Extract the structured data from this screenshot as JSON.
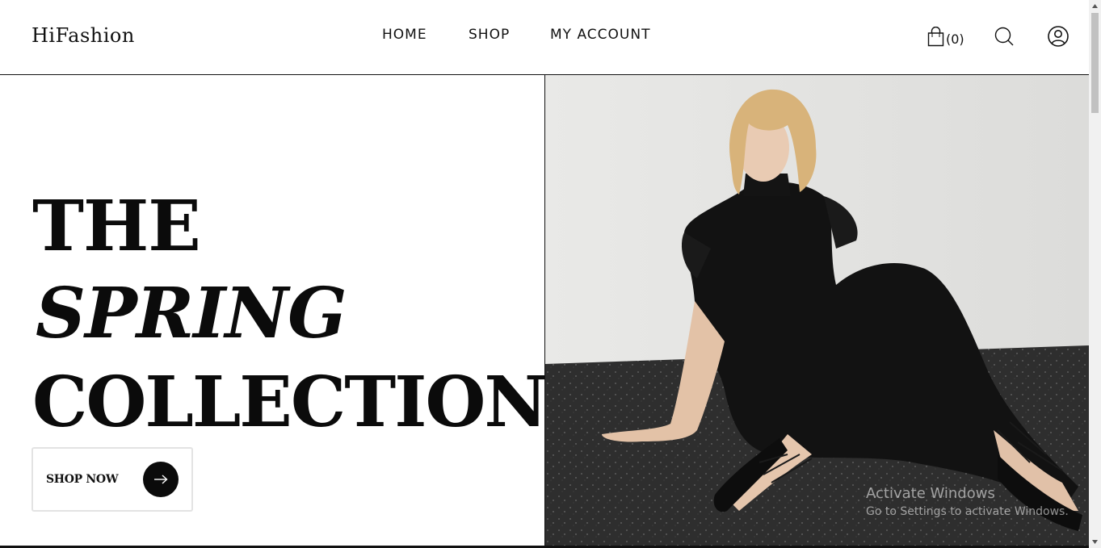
{
  "header": {
    "logo": "HiFashion",
    "nav": {
      "home": "HOME",
      "shop": "SHOP",
      "account": "MY ACCOUNT"
    },
    "cart_count": "(0)",
    "icons": [
      "cart-icon",
      "search-icon",
      "user-account-icon"
    ]
  },
  "hero": {
    "line1": "THE",
    "line2": "SPRING",
    "line3": "COLLECTION",
    "cta_label": "SHOP NOW",
    "cta_icon": "arrow-right-icon",
    "image_description_icon": "model-photo"
  },
  "watermark": {
    "title": "Activate Windows",
    "subtitle": "Go to Settings to activate Windows."
  },
  "colors": {
    "text": "#111111",
    "background": "#ffffff",
    "cta_circle": "#0b0b0b",
    "cta_border": "#e3e3e3"
  }
}
